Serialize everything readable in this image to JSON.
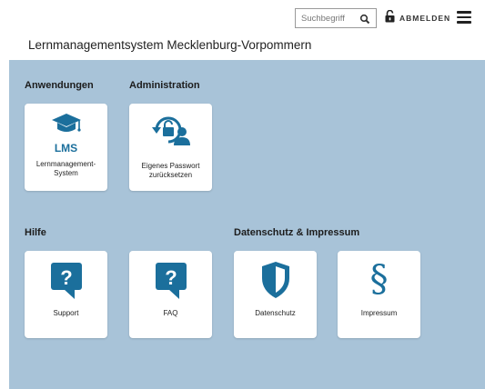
{
  "header": {
    "search_placeholder": "Suchbegriff",
    "search_icon": "search-icon",
    "logout_label": "ABMELDEN",
    "logout_icon": "unlock-icon",
    "menu_icon": "hamburger-menu-icon"
  },
  "site_title": "Lernmanagementsystem Mecklenburg-Vorpommern",
  "colors": {
    "accent": "#1b6f9c",
    "main_background": "#a8c3d8",
    "tile_background": "#ffffff"
  },
  "sections": [
    {
      "heading": "Anwendungen",
      "tiles": [
        {
          "icon_text": "LMS",
          "label": "Lernmanagement- System",
          "icon": "graduation-cap-icon"
        }
      ]
    },
    {
      "heading": "Administration",
      "tiles": [
        {
          "label": "Eigenes Passwort zurücksetzen",
          "icon": "password-reset-icon"
        }
      ]
    },
    {
      "heading": "Hilfe",
      "tiles": [
        {
          "icon_text": "?",
          "label": "Support",
          "icon": "question-bubble-icon"
        },
        {
          "icon_text": "?",
          "label": "FAQ",
          "icon": "question-bubble-icon"
        }
      ]
    },
    {
      "heading": "Datenschutz & Impressum",
      "tiles": [
        {
          "label": "Datenschutz",
          "icon": "shield-icon"
        },
        {
          "icon_text": "§",
          "label": "Impressum",
          "icon": "paragraph-sign-icon"
        }
      ]
    }
  ]
}
